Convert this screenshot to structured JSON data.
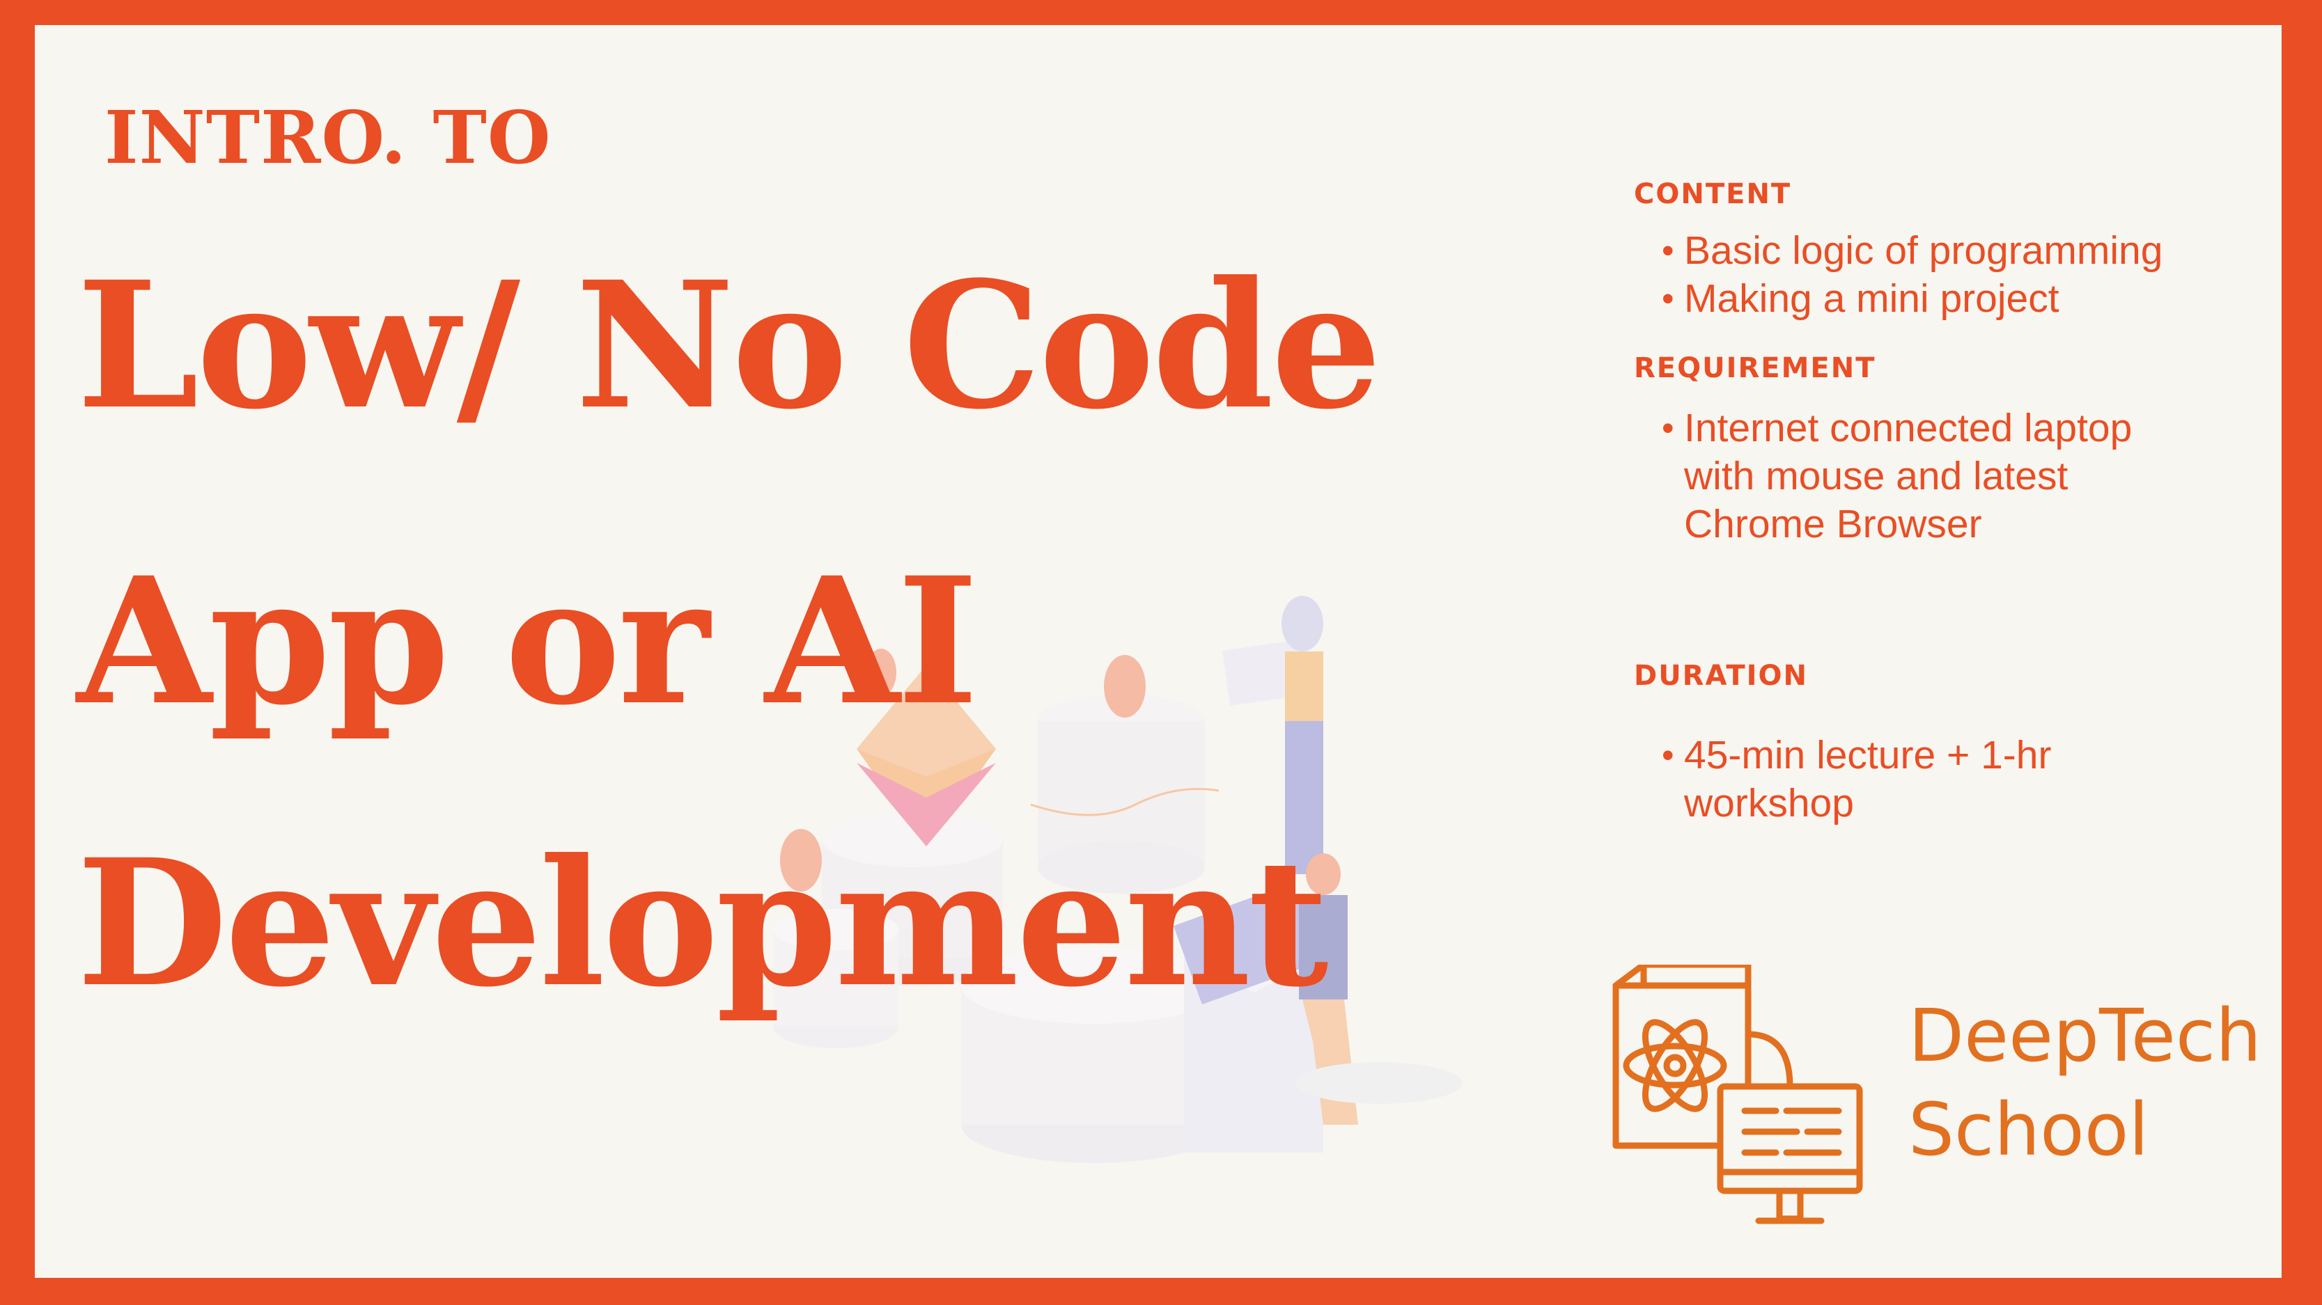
{
  "header": {
    "kicker": "INTRO. TO",
    "title_lines": [
      "Low/ No Code",
      "App or AI",
      "Development"
    ]
  },
  "sections": [
    {
      "heading": "CONTENT",
      "items": [
        "Basic logic of programming",
        "Making a mini project"
      ]
    },
    {
      "heading": "REQUIREMENT",
      "items": [
        "Internet connected laptop with mouse and latest Chrome Browser"
      ]
    },
    {
      "heading": "DURATION",
      "items": [
        "45-min lecture + 1-hr workshop"
      ]
    }
  ],
  "logo": {
    "line1": "DeepTech",
    "line2": "School",
    "icon": "atom-computer-icon"
  },
  "colors": {
    "accent": "#e94e24",
    "logo": "#e2701f",
    "background": "#f8f6f1"
  },
  "bullet": "•"
}
